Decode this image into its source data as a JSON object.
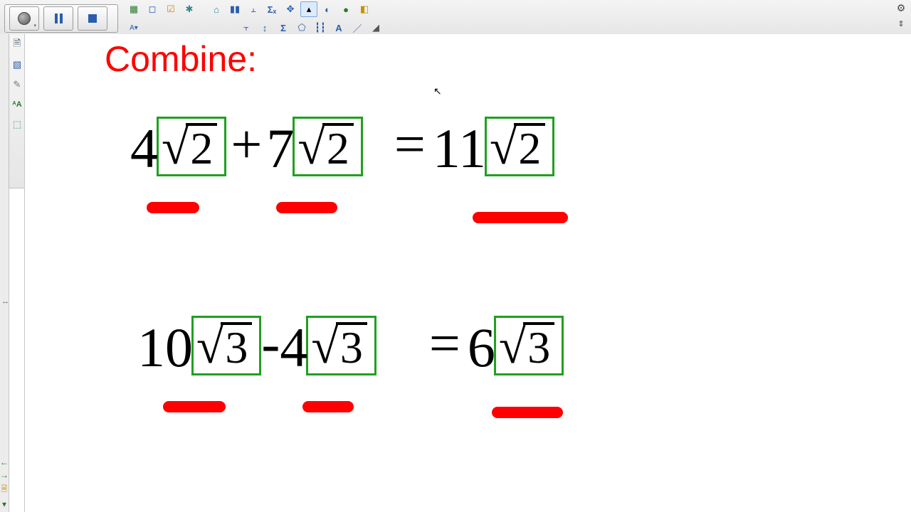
{
  "app": {
    "title": "Combine:"
  },
  "controls": {
    "record": "Record",
    "pause": "Pause",
    "stop": "Stop",
    "gear": "Settings",
    "expand": "Expand toolbar"
  },
  "toolbar": {
    "row1": [
      "table",
      "capture-region",
      "check",
      "pin",
      "unpin",
      "bar-chart",
      "align-top",
      "sigma-x",
      "crosshair",
      "pointer",
      "callout",
      "paint",
      "erase-light"
    ],
    "row2": [
      "text-small",
      "align-bottom",
      "align-v",
      "sigma",
      "polygon",
      "sliders",
      "letter",
      "line",
      "eraser"
    ]
  },
  "sidebar": {
    "tools": [
      "new-page",
      "image",
      "pen",
      "text-style",
      "puzzle"
    ],
    "nav": [
      "prev",
      "next",
      "page-add",
      "page-down"
    ]
  },
  "equations": [
    {
      "lhs": [
        {
          "coef": "4",
          "radicand": "2"
        },
        {
          "op": "+"
        },
        {
          "coef": "7",
          "radicand": "2"
        }
      ],
      "rhs": {
        "coef": "11",
        "radicand": "2"
      }
    },
    {
      "lhs": [
        {
          "coef": "10",
          "radicand": "3"
        },
        {
          "op": "-"
        },
        {
          "coef": "4",
          "radicand": "3"
        }
      ],
      "rhs": {
        "coef": "6",
        "radicand": "3"
      }
    }
  ],
  "colors": {
    "accent_red": "#ff0000",
    "box_green": "#20a020"
  }
}
